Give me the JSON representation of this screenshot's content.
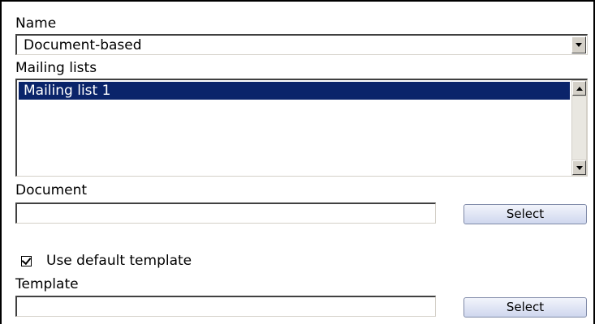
{
  "form": {
    "name_label": "Name",
    "name_value": "Document-based",
    "mailing_lists_label": "Mailing lists",
    "mailing_lists": [
      "Mailing list 1"
    ],
    "document_label": "Document",
    "document_value": "",
    "document_select_label": "Select",
    "use_default_template_label": "Use default template",
    "use_default_template_checked": true,
    "template_label": "Template",
    "template_value": "",
    "template_select_label": "Select"
  },
  "colors": {
    "selection_bg": "#0a246a",
    "button_gradient_top": "#f2f4fb",
    "button_gradient_bottom": "#cfd7ee"
  }
}
